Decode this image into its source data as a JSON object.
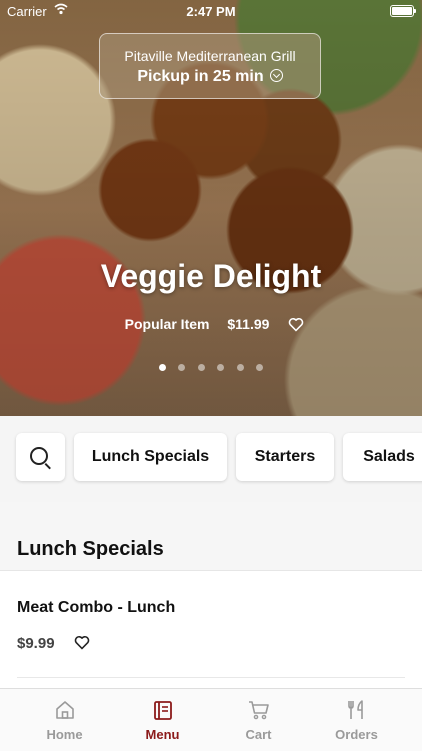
{
  "status_bar": {
    "carrier": "Carrier",
    "time": "2:47 PM"
  },
  "restaurant": {
    "name": "Pitaville Mediterranean Grill",
    "pickup": "Pickup in 25 min"
  },
  "featured": {
    "title": "Veggie Delight",
    "tag": "Popular Item",
    "price": "$11.99",
    "slides": 6,
    "active_slide": 1
  },
  "categories": [
    "Lunch Specials",
    "Starters",
    "Salads"
  ],
  "section": {
    "title": "Lunch Specials"
  },
  "items": [
    {
      "name": "Meat Combo - Lunch",
      "price": "$9.99"
    }
  ],
  "tabs": [
    {
      "label": "Home",
      "icon": "home-icon"
    },
    {
      "label": "Menu",
      "icon": "menu-icon"
    },
    {
      "label": "Cart",
      "icon": "cart-icon"
    },
    {
      "label": "Orders",
      "icon": "orders-icon"
    }
  ],
  "colors": {
    "accent": "#8b1a1a",
    "inactive": "#9a9a9a"
  }
}
